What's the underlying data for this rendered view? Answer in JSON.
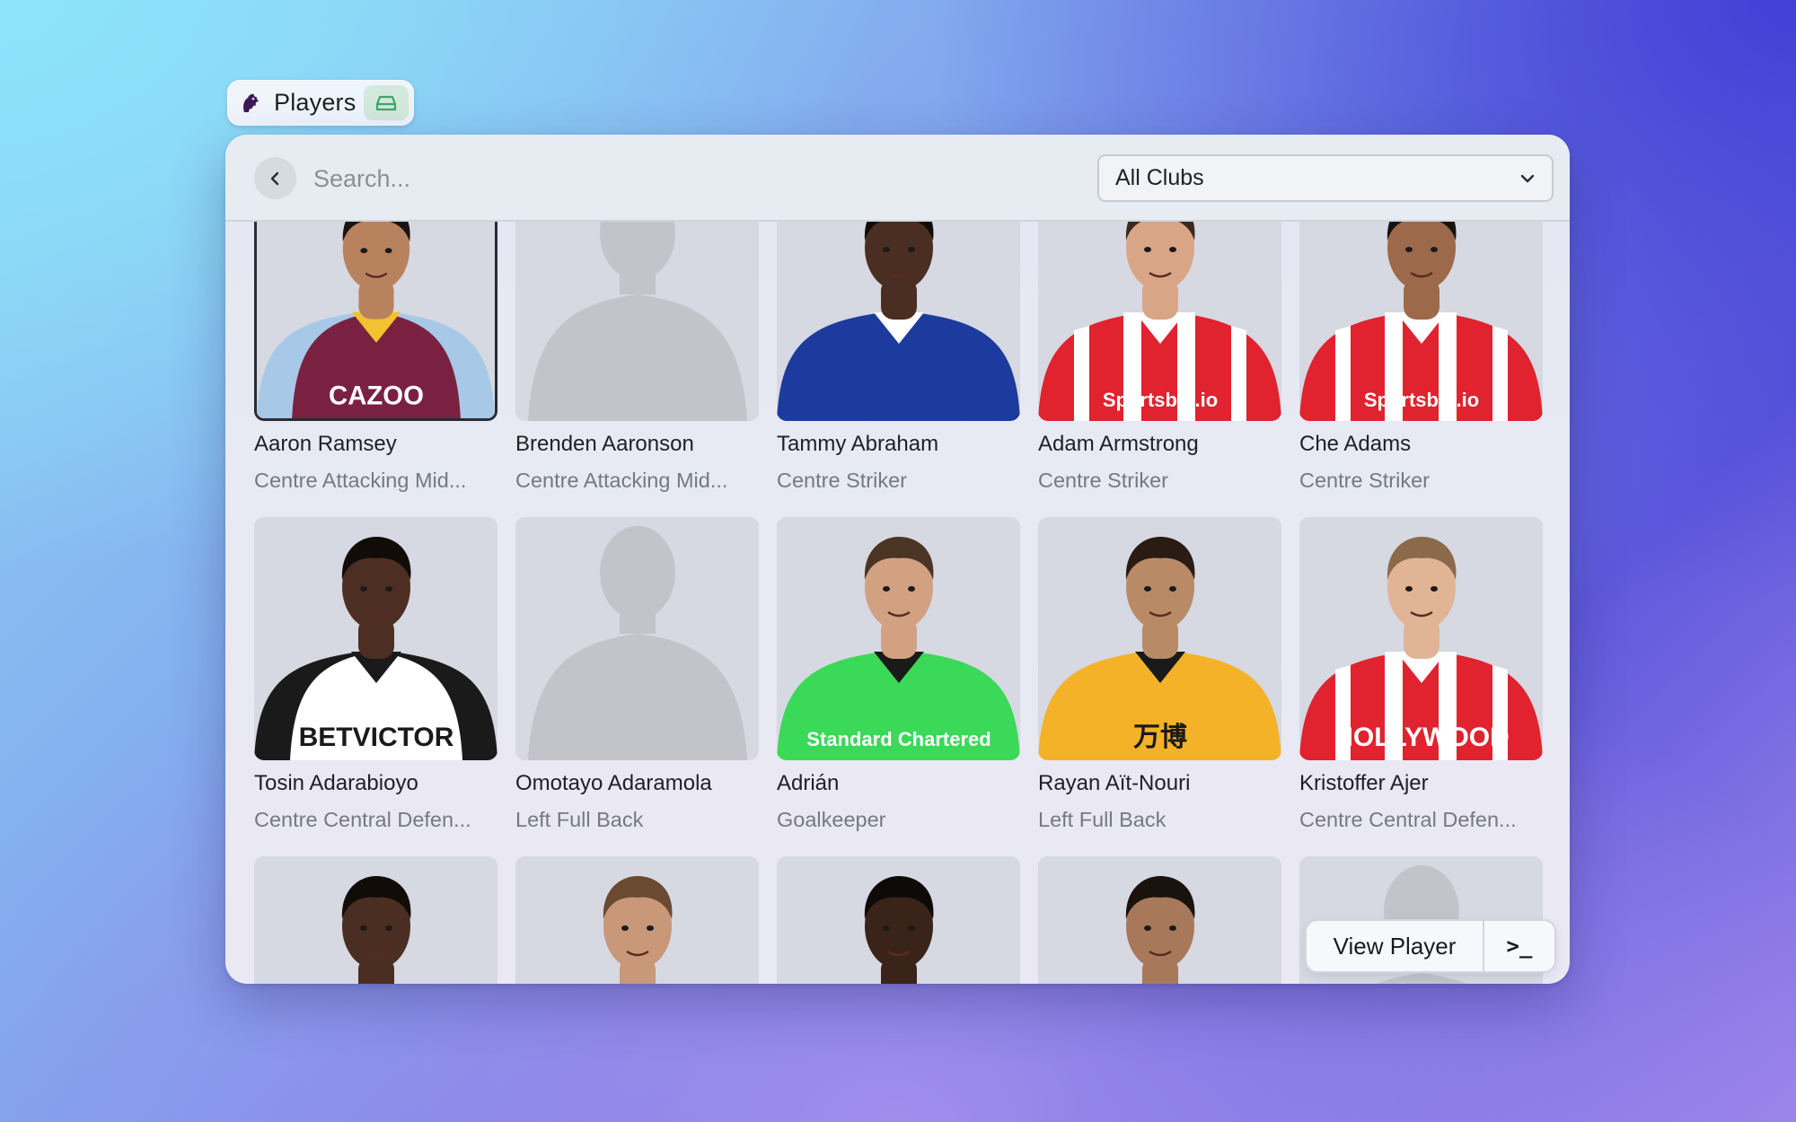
{
  "tab": {
    "title": "Players",
    "logo_icon": "premier-league-lion-icon",
    "extension_icon": "drive-icon"
  },
  "toolbar": {
    "back_icon": "chevron-left-icon",
    "search_placeholder": "Search...",
    "search_value": "",
    "club_filter": {
      "selected": "All Clubs",
      "icon": "chevron-down-icon"
    }
  },
  "players": [
    {
      "name": "Aaron Ramsey",
      "position": "Centre Attacking Mid...",
      "selected": true,
      "has_photo": true,
      "skin": "#b9825e",
      "hair": "#1a1410",
      "kit": {
        "primary": "#7a2142",
        "sleeve": "#a8c8e8",
        "accent": "#f2c230",
        "text": "CAZOO"
      }
    },
    {
      "name": "Brenden Aaronson",
      "position": "Centre Attacking Mid...",
      "selected": false,
      "has_photo": false
    },
    {
      "name": "Tammy Abraham",
      "position": "Centre Striker",
      "selected": false,
      "has_photo": true,
      "skin": "#4a2e22",
      "hair": "#120c08",
      "kit": {
        "primary": "#1d3a9e",
        "sleeve": "#1d3a9e",
        "accent": "#ffffff",
        "text": ""
      }
    },
    {
      "name": "Adam Armstrong",
      "position": "Centre Striker",
      "selected": false,
      "has_photo": true,
      "skin": "#d8a686",
      "hair": "#3a2a1e",
      "kit": {
        "primary": "#e0232e",
        "sleeve": "#e0232e",
        "accent": "#ffffff",
        "text": "Sportsbet.io"
      }
    },
    {
      "name": "Che Adams",
      "position": "Centre Striker",
      "selected": false,
      "has_photo": true,
      "skin": "#9c6a4a",
      "hair": "#1a120c",
      "kit": {
        "primary": "#e0232e",
        "sleeve": "#e0232e",
        "accent": "#ffffff",
        "text": "Sportsbet.io"
      }
    },
    {
      "name": "Tosin Adarabioyo",
      "position": "Centre Central Defen...",
      "selected": false,
      "has_photo": true,
      "skin": "#4c2f22",
      "hair": "#120c08",
      "kit": {
        "primary": "#ffffff",
        "sleeve": "#1a1a1a",
        "accent": "#1a1a1a",
        "text": "BETVICTOR"
      }
    },
    {
      "name": "Omotayo Adaramola",
      "position": "Left Full Back",
      "selected": false,
      "has_photo": false
    },
    {
      "name": "Adrián",
      "position": "Goalkeeper",
      "selected": false,
      "has_photo": true,
      "skin": "#d2a182",
      "hair": "#4a3424",
      "kit": {
        "primary": "#3ad957",
        "sleeve": "#3ad957",
        "accent": "#1a1a1a",
        "text": "Standard Chartered"
      }
    },
    {
      "name": "Rayan Aït-Nouri",
      "position": "Left Full Back",
      "selected": false,
      "has_photo": true,
      "skin": "#b98a66",
      "hair": "#2a1c12",
      "kit": {
        "primary": "#f4b228",
        "sleeve": "#f4b228",
        "accent": "#1a1a1a",
        "text": "万博"
      }
    },
    {
      "name": "Kristoffer Ajer",
      "position": "Centre Central Defen...",
      "selected": false,
      "has_photo": true,
      "skin": "#e2b496",
      "hair": "#8a6a4a",
      "kit": {
        "primary": "#e0232e",
        "sleeve": "#e0232e",
        "accent": "#ffffff",
        "text": "HOLLYWOOD"
      }
    },
    {
      "name": "",
      "position": "",
      "selected": false,
      "has_photo": true,
      "skin": "#4a2e22",
      "hair": "#120c08",
      "kit": {
        "primary": "#d6d8e2",
        "sleeve": "#d6d8e2",
        "accent": "#d6d8e2",
        "text": ""
      }
    },
    {
      "name": "",
      "position": "",
      "selected": false,
      "has_photo": true,
      "skin": "#c89878",
      "hair": "#6a4a30",
      "kit": {
        "primary": "#d6d8e2",
        "sleeve": "#d6d8e2",
        "accent": "#d6d8e2",
        "text": ""
      }
    },
    {
      "name": "",
      "position": "",
      "selected": false,
      "has_photo": true,
      "skin": "#3a241a",
      "hair": "#0e0a08",
      "kit": {
        "primary": "#d6d8e2",
        "sleeve": "#d6d8e2",
        "accent": "#d6d8e2",
        "text": ""
      }
    },
    {
      "name": "",
      "position": "",
      "selected": false,
      "has_photo": true,
      "skin": "#a8785a",
      "hair": "#1a120c",
      "kit": {
        "primary": "#d6d8e2",
        "sleeve": "#d6d8e2",
        "accent": "#d6d8e2",
        "text": ""
      }
    },
    {
      "name": "",
      "position": "",
      "selected": false,
      "has_photo": false
    }
  ],
  "actions": {
    "primary_label": "View Player",
    "secondary_label": ">_",
    "secondary_icon": "terminal-icon"
  }
}
